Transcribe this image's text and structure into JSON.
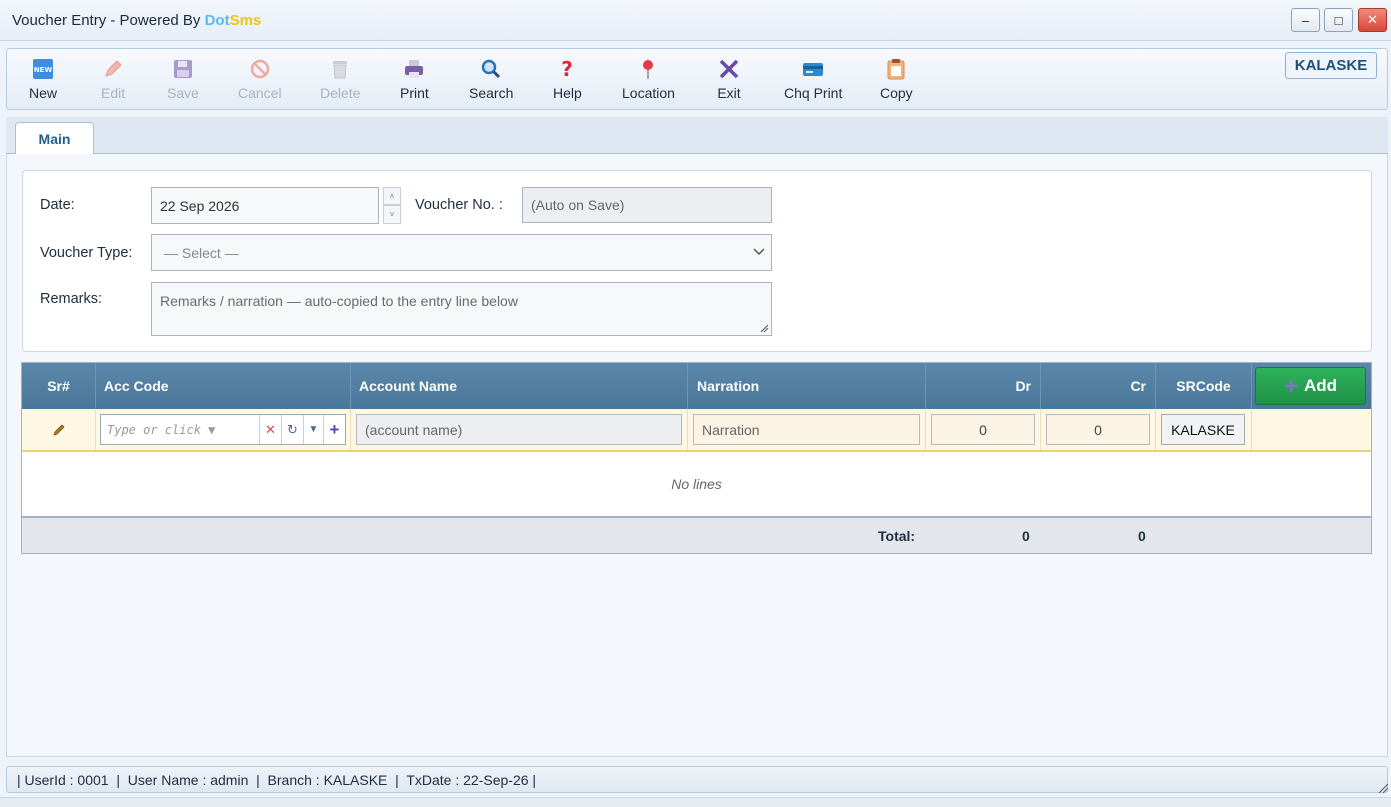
{
  "window": {
    "title_prefix": "Voucher Entry - Powered By ",
    "brand_dot": "Dot",
    "brand_sms": "Sms",
    "minimize": "–",
    "maximize": "□",
    "close": "✕"
  },
  "toolbar": {
    "items": [
      {
        "label": "New",
        "icon": "new-icon",
        "enabled": true
      },
      {
        "label": "Edit",
        "icon": "pencil-icon",
        "enabled": false
      },
      {
        "label": "Save",
        "icon": "floppy-icon",
        "enabled": false
      },
      {
        "label": "Cancel",
        "icon": "cancel-icon",
        "enabled": false
      },
      {
        "label": "Delete",
        "icon": "trash-icon",
        "enabled": false
      },
      {
        "label": "Print",
        "icon": "printer-icon",
        "enabled": true
      },
      {
        "label": "Search",
        "icon": "magnifier-icon",
        "enabled": true
      },
      {
        "label": "Help",
        "icon": "question-icon",
        "enabled": true
      },
      {
        "label": "Location",
        "icon": "pin-icon",
        "enabled": true
      },
      {
        "label": "Exit",
        "icon": "x-icon",
        "enabled": true
      },
      {
        "label": "Chq Print",
        "icon": "card-icon",
        "enabled": true
      },
      {
        "label": "Copy",
        "icon": "clipboard-icon",
        "enabled": true
      }
    ],
    "branch": "KALASKE"
  },
  "tabs": [
    {
      "label": "Main",
      "active": true
    }
  ],
  "form": {
    "date_label": "Date:",
    "date_value": "22 Sep 2026",
    "voucher_no_label": "Voucher No. :",
    "voucher_no_placeholder": "(Auto on Save)",
    "voucher_type_label": "Voucher Type:",
    "voucher_type_value": "— Select —",
    "remarks_label": "Remarks:",
    "remarks_placeholder": "Remarks / narration — auto-copied to the entry line below"
  },
  "grid": {
    "columns": {
      "sr": "Sr#",
      "acc_code": "Acc Code",
      "account_name": "Account Name",
      "narration": "Narration",
      "dr": "Dr",
      "cr": "Cr",
      "srcode": "SRCode"
    },
    "add_label": "Add",
    "entry": {
      "acc_code_placeholder": "Type or click ▼",
      "account_name_placeholder": "(account name)",
      "narration_placeholder": "Narration",
      "dr": "0",
      "cr": "0",
      "srcode": "KALASKE"
    },
    "empty_text": "No lines",
    "total_label": "Total:",
    "total_dr": "0",
    "total_cr": "0"
  },
  "status": {
    "text": "| UserId : 0001  |  User Name : admin  |  Branch : KALASKE  |  TxDate : 22-Sep-26 |"
  },
  "colors": {
    "header": "#4f7ca0",
    "add_button": "#22a04f",
    "entry_row": "#fdf7e3",
    "brand_dot": "#5cb8f2",
    "brand_sms": "#f0c419"
  }
}
